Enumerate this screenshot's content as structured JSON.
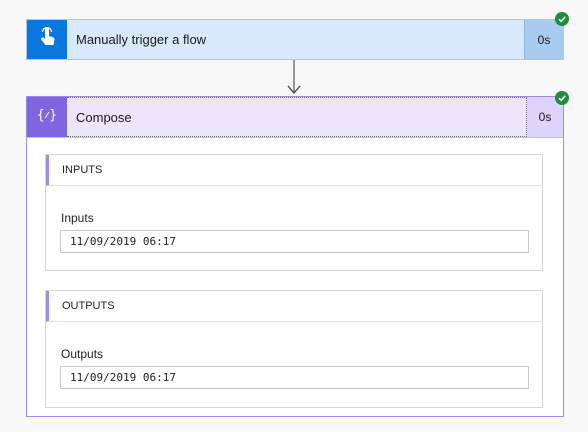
{
  "trigger": {
    "title": "Manually trigger a flow",
    "duration": "0s",
    "status_icon": "success-check-icon",
    "icon": "touch-hand-icon"
  },
  "compose": {
    "title": "Compose",
    "duration": "0s",
    "status_icon": "success-check-icon",
    "icon": "compose-braces-icon",
    "inputs": {
      "section_title": "INPUTS",
      "label": "Inputs",
      "value": "11/09/2019 06:17"
    },
    "outputs": {
      "section_title": "OUTPUTS",
      "label": "Outputs",
      "value": "11/09/2019 06:17"
    }
  },
  "colors": {
    "trigger_accent": "#0a76e0",
    "compose_accent": "#7e66e0",
    "success": "#1c8f3a"
  }
}
